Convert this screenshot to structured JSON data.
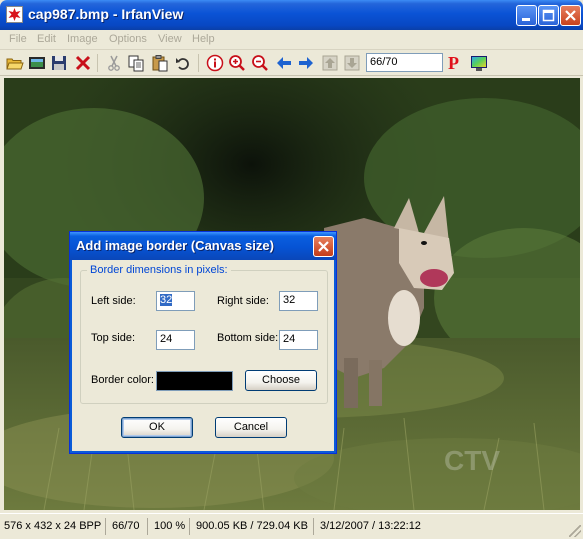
{
  "window": {
    "title": "cap987.bmp - IrfanView",
    "minimize_icon": "minimize-icon",
    "maximize_icon": "maximize-icon",
    "close_icon": "close-icon"
  },
  "menu": [
    "File",
    "Edit",
    "Image",
    "Options",
    "View",
    "Help"
  ],
  "toolbar": {
    "page_field_value": "66/70",
    "p_logo": "P",
    "icons": [
      "open-folder-icon",
      "slideshow-icon",
      "save-icon",
      "delete-icon",
      "cut-icon",
      "copy-icon",
      "paste-icon",
      "undo-icon",
      "info-icon",
      "zoom-in-icon",
      "zoom-out-icon",
      "previous-icon",
      "next-icon",
      "first-icon",
      "last-icon",
      "paint-icon",
      "screen-icon"
    ]
  },
  "dialog": {
    "title": "Add image border (Canvas size)",
    "group_label": "Border dimensions in pixels:",
    "left_label": "Left side:",
    "left_value": "32",
    "right_label": "Right side:",
    "right_value": "32",
    "top_label": "Top side:",
    "top_value": "24",
    "bottom_label": "Bottom side:",
    "bottom_value": "24",
    "border_color_label": "Border color:",
    "border_color_value": "#000000",
    "choose_label": "Choose",
    "ok_label": "OK",
    "cancel_label": "Cancel"
  },
  "status": {
    "dimensions": "576 x 432 x 24 BPP",
    "page": "66/70",
    "zoom": "100 %",
    "size": "900.05 KB / 729.04 KB",
    "datetime": "3/12/2007 / 13:22:12"
  },
  "image": {
    "watermark": "CTV"
  }
}
